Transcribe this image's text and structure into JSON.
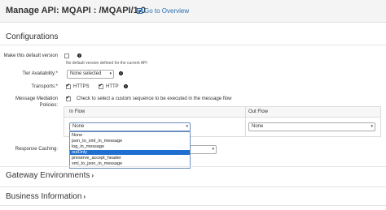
{
  "header": {
    "title": "Manage API: MQAPI : /MQAPI/1.0",
    "overview_link": "Go to Overview"
  },
  "configurations": {
    "title": "Configurations",
    "default_version": {
      "label": "Make this default version",
      "hint": "No default version defined for the current API",
      "checked": false
    },
    "tier": {
      "label": "Tier Availability:*",
      "value": "None selected"
    },
    "transports": {
      "label": "Transports:*",
      "options": [
        {
          "label": "HTTPS",
          "checked": true
        },
        {
          "label": "HTTP",
          "checked": true
        }
      ]
    },
    "mediation": {
      "label_line1": "Message Mediation",
      "label_line2": "Policies:",
      "checkbox_text": "Check to select a custom sequence to be executed in the message flow",
      "checked": true,
      "in_flow_header": "In Flow",
      "out_flow_header": "Out Flow",
      "in_flow_value": "None",
      "out_flow_value": "None",
      "in_flow_options": [
        "None",
        "json_to_xml_in_message",
        "log_in_message",
        "outOnly",
        "preserve_accept_header",
        "xml_to_json_in_message"
      ],
      "selected_option": "outOnly"
    },
    "response_caching": {
      "label": "Response Caching:"
    }
  },
  "gateway_environments": {
    "title": "Gateway Environments"
  },
  "business_information": {
    "title": "Business Information"
  },
  "colors": {
    "link": "#2a6fb0",
    "selected_option_bg": "#1f6fd0",
    "header_bg": "#f4f4f4"
  }
}
